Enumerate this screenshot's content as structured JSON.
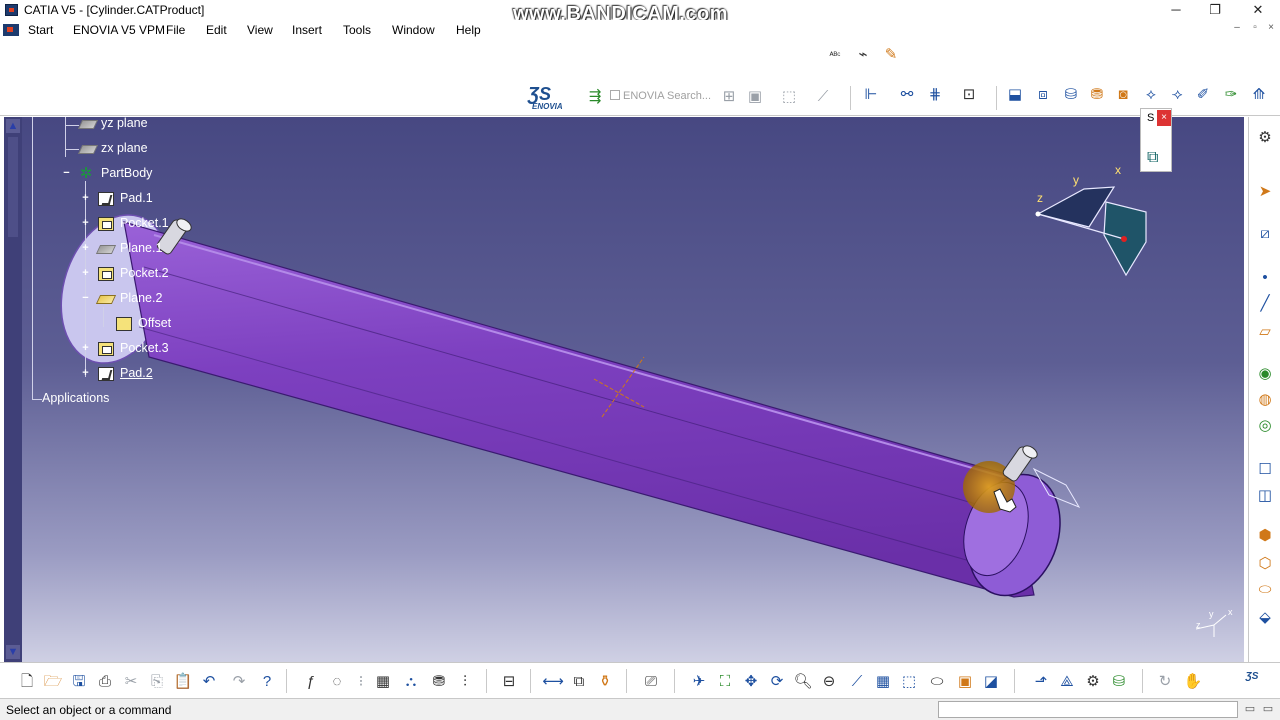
{
  "window": {
    "title": "CATIA V5 - [Cylinder.CATProduct]",
    "watermark": "www.BANDICAM.com",
    "controls": [
      "─",
      "❐",
      "✕"
    ]
  },
  "menu": {
    "items": [
      "Start",
      "ENOVIA V5 VPM",
      "File",
      "Edit",
      "View",
      "Insert",
      "Tools",
      "Window",
      "Help"
    ],
    "doc_controls": [
      "–",
      "▫",
      "×"
    ]
  },
  "toolbar": {
    "enovia_label": "ENOVIA",
    "enovia_search_placeholder": "ENOVIA Search...",
    "top_icons": [
      "abc-text-icon",
      "fly-icon",
      "paint-icon",
      "ds-logo-icon",
      "search-toolbar-icon"
    ]
  },
  "tree": {
    "nodes": [
      {
        "label": "yz plane",
        "type": "plane"
      },
      {
        "label": "zx plane",
        "type": "plane"
      },
      {
        "label": "PartBody",
        "type": "body"
      },
      {
        "label": "Pad.1",
        "type": "pad"
      },
      {
        "label": "Pocket.1",
        "type": "pocket"
      },
      {
        "label": "Plane.1",
        "type": "plane"
      },
      {
        "label": "Pocket.2",
        "type": "pocket"
      },
      {
        "label": "Plane.2",
        "type": "plane"
      },
      {
        "label": "Offset",
        "type": "offset"
      },
      {
        "label": "Pocket.3",
        "type": "pocket"
      },
      {
        "label": "Pad.2",
        "type": "pad"
      },
      {
        "label": "Applications",
        "type": "root"
      }
    ]
  },
  "compass": {
    "x_label": "x",
    "y_label": "y",
    "z_label": "z"
  },
  "axis_indicator": {
    "x_label": "x",
    "y_label": "y",
    "z_label": "z"
  },
  "float_toolbar": {
    "label": "S",
    "close": "×"
  },
  "status": {
    "message": "Select an object or a command",
    "command_input": ""
  },
  "colors": {
    "part": "#7a3fb8",
    "background_top": "#474882",
    "background_bottom": "#cfd0e4"
  }
}
